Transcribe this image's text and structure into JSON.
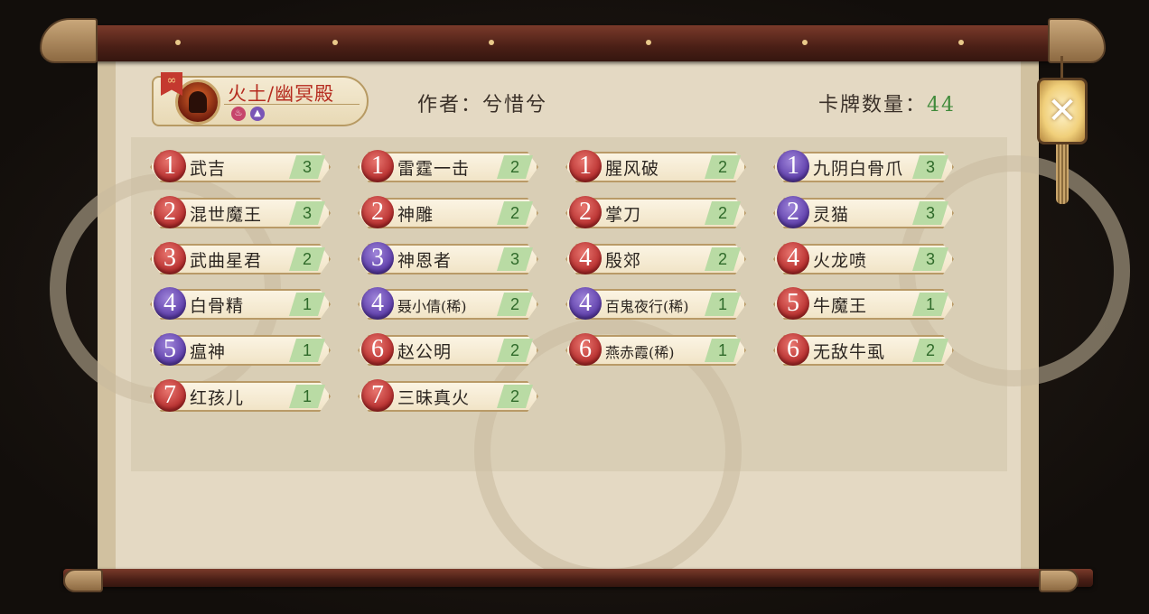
{
  "header": {
    "deck_name": "火土/幽冥殿",
    "link_icon": "link-icon",
    "element_icons": [
      "fire-element-icon",
      "earth-element-icon"
    ],
    "author_label": "作者：",
    "author_name": "兮惜兮",
    "count_label": "卡牌数量：",
    "count_value": "44"
  },
  "cards": [
    {
      "cost": "1",
      "color": "red",
      "name": "武吉",
      "qty": "3"
    },
    {
      "cost": "1",
      "color": "red",
      "name": "雷霆一击",
      "qty": "2"
    },
    {
      "cost": "1",
      "color": "red",
      "name": "腥风破",
      "qty": "2"
    },
    {
      "cost": "1",
      "color": "purple",
      "name": "九阴白骨爪",
      "qty": "3"
    },
    {
      "cost": "2",
      "color": "red",
      "name": "混世魔王",
      "qty": "3"
    },
    {
      "cost": "2",
      "color": "red",
      "name": "神雕",
      "qty": "2"
    },
    {
      "cost": "2",
      "color": "red",
      "name": "掌刀",
      "qty": "2"
    },
    {
      "cost": "2",
      "color": "purple",
      "name": "灵猫",
      "qty": "3"
    },
    {
      "cost": "3",
      "color": "red",
      "name": "武曲星君",
      "qty": "2"
    },
    {
      "cost": "3",
      "color": "purple",
      "name": "神恩者",
      "qty": "3"
    },
    {
      "cost": "4",
      "color": "red",
      "name": "殷郊",
      "qty": "2"
    },
    {
      "cost": "4",
      "color": "red",
      "name": "火龙喷",
      "qty": "3"
    },
    {
      "cost": "4",
      "color": "purple",
      "name": "白骨精",
      "qty": "1"
    },
    {
      "cost": "4",
      "color": "purple",
      "name": "聂小倩(稀)",
      "qty": "2"
    },
    {
      "cost": "4",
      "color": "purple",
      "name": "百鬼夜行(稀)",
      "qty": "1"
    },
    {
      "cost": "5",
      "color": "red",
      "name": "牛魔王",
      "qty": "1"
    },
    {
      "cost": "5",
      "color": "purple",
      "name": "瘟神",
      "qty": "1"
    },
    {
      "cost": "6",
      "color": "red",
      "name": "赵公明",
      "qty": "2"
    },
    {
      "cost": "6",
      "color": "red",
      "name": "燕赤霞(稀)",
      "qty": "1"
    },
    {
      "cost": "6",
      "color": "red",
      "name": "无敌牛虱",
      "qty": "2"
    },
    {
      "cost": "7",
      "color": "red",
      "name": "红孩儿",
      "qty": "1"
    },
    {
      "cost": "7",
      "color": "red",
      "name": "三昧真火",
      "qty": "2"
    }
  ],
  "close_button": {
    "label": "✕",
    "icon": "close-icon"
  },
  "colors": {
    "cost_red": "#b42a2a",
    "cost_purple": "#5a3aa8",
    "qty_green": "#3f8a3a",
    "deck_name_red": "#b52a1e"
  }
}
